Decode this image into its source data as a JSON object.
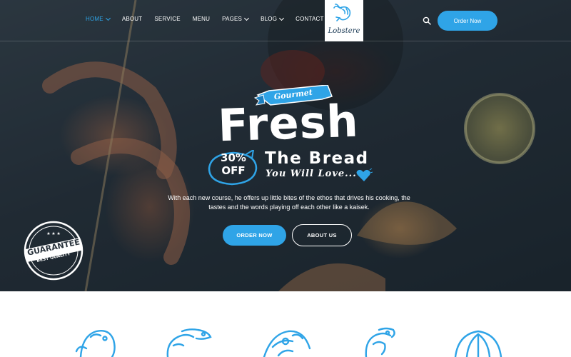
{
  "nav": {
    "items": [
      {
        "label": "HOME",
        "dropdown": true,
        "active": true
      },
      {
        "label": "ABOUT",
        "dropdown": false,
        "active": false
      },
      {
        "label": "SERVICE",
        "dropdown": false,
        "active": false
      },
      {
        "label": "MENU",
        "dropdown": false,
        "active": false
      },
      {
        "label": "PAGES",
        "dropdown": true,
        "active": false
      },
      {
        "label": "BLOG",
        "dropdown": true,
        "active": false
      },
      {
        "label": "CONTACT",
        "dropdown": false,
        "active": false
      }
    ]
  },
  "logo": {
    "text": "Lobstere",
    "icon": "shrimp-icon"
  },
  "header": {
    "search_icon": "search-icon",
    "order_label": "Order Now"
  },
  "hero": {
    "ribbon": "Gourmet",
    "headline": "Fresh",
    "badge_percent": "30%",
    "badge_off": "OFF",
    "subheadline": "The Bread",
    "tagline": "You Will Love...",
    "description": "With each new course, he offers up little bites of the ethos that drives his cooking, the tastes and the words playing off each other like a kaisek.",
    "order_button": "ORDER NOW",
    "about_button": "ABOUT US",
    "stamp_top": "GUARANTEE",
    "stamp_bottom": "BEST QUALITY"
  },
  "features": {
    "icons": [
      "fish-icon",
      "shrimp-icon",
      "crab-icon",
      "lobster-icon",
      "shell-icon"
    ]
  },
  "colors": {
    "accent": "#2fa4e7",
    "logo_text": "#1b3a55",
    "hero_overlay": "#1f2830",
    "white": "#ffffff"
  }
}
